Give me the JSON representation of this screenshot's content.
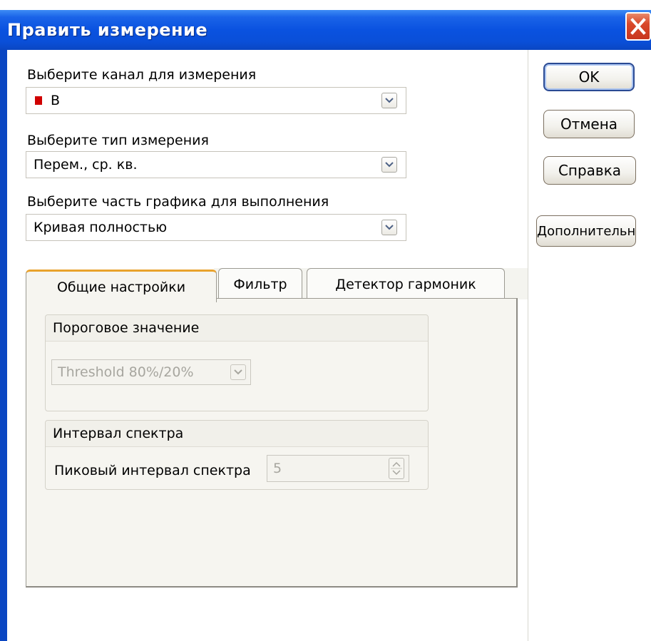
{
  "window": {
    "title": "Править измерение",
    "accent_color": "#0a52e0",
    "close_icon": "close-icon"
  },
  "channel": {
    "label": "Выберите канал для измерения",
    "value": "B",
    "swatch_color": "#d00000"
  },
  "measure_type": {
    "label": "Выберите тип измерения",
    "value": "Перем., ср. кв."
  },
  "graph_part": {
    "label": "Выберите часть графика для выполнения",
    "value": "Кривая полностью"
  },
  "buttons": {
    "ok": "OK",
    "cancel": "Отмена",
    "help": "Справка",
    "more": "Дополнительно"
  },
  "tabs": [
    {
      "label": "Общие настройки",
      "active": true
    },
    {
      "label": "Фильтр",
      "active": false
    },
    {
      "label": "Детектор гармоник",
      "active": false
    }
  ],
  "threshold_group": {
    "title": "Пороговое значение",
    "value": "Threshold 80%/20%"
  },
  "spectrum_group": {
    "title": "Интервал спектра",
    "field_label": "Пиковый интервал спектра",
    "field_value": "5"
  }
}
